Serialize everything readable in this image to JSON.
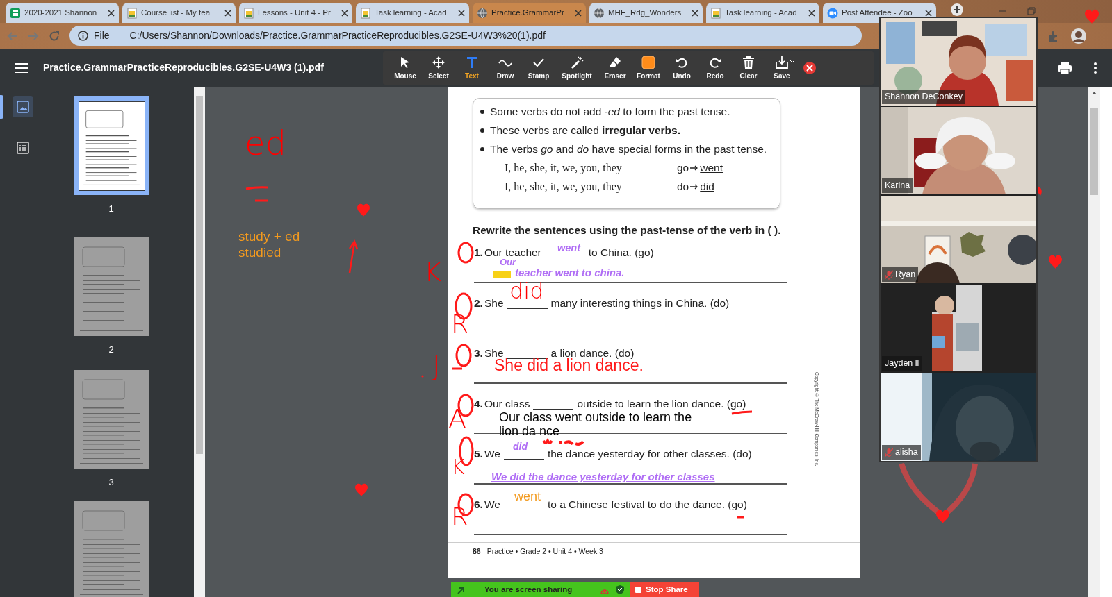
{
  "browser": {
    "tabs": [
      {
        "title": "2020-2021 Shannon",
        "selected": false
      },
      {
        "title": "Course list - My tea",
        "selected": false
      },
      {
        "title": "Lessons - Unit 4 - Pr",
        "selected": false
      },
      {
        "title": "Task learning - Acad",
        "selected": false
      },
      {
        "title": "Practice.GrammarPr",
        "selected": true
      },
      {
        "title": "MHE_Rdg_Wonders",
        "selected": false
      },
      {
        "title": "Task learning - Acad",
        "selected": false
      },
      {
        "title": "Post Attendee - Zoo",
        "selected": false
      }
    ],
    "address": {
      "scheme": "File",
      "url": "C:/Users/Shannon/Downloads/Practice.GrammarPracticeReproducibles.G2SE-U4W3%20(1).pdf"
    }
  },
  "pdf_viewer": {
    "filename": "Practice.GrammarPracticeReproducibles.G2SE-U4W3 (1).pdf",
    "sidebar": {
      "views": [
        {
          "kind": "thumbnails",
          "selected": true
        },
        {
          "kind": "outline",
          "selected": false
        }
      ],
      "thumbnails": [
        {
          "label": "1",
          "selected": true
        },
        {
          "label": "2",
          "selected": false
        },
        {
          "label": "3",
          "selected": false
        },
        {
          "selected": false
        }
      ]
    },
    "page": {
      "rules": [
        {
          "text": "Some verbs do not add *-ed* to form the past tense."
        },
        {
          "text": "These verbs are called **irregular verbs.**"
        },
        {
          "text": "The verbs *go* and *do* have special forms in the past tense."
        }
      ],
      "forms": [
        {
          "pronouns": "I, he, she, it, we, you, they",
          "verb": "go",
          "past": "went"
        },
        {
          "pronouns": "I, he, she, it, we, you, they",
          "verb": "do",
          "past": "did"
        }
      ],
      "instruction": "Rewrite the sentences using the past-tense of the verb in ( ).",
      "questions": [
        {
          "number": "1.",
          "before": "Our teacher",
          "after": "to China. (go)"
        },
        {
          "number": "2.",
          "before": "She",
          "after": "many interesting things in China. (do)"
        },
        {
          "number": "3.",
          "before": "She",
          "after": "a lion dance. (do)"
        },
        {
          "number": "4.",
          "before": "Our class",
          "after": "outside to learn the lion dance. (go)"
        },
        {
          "number": "5.",
          "before": "We",
          "after": "the dance yesterday for other classes. (do)"
        },
        {
          "number": "6.",
          "before": "We",
          "after": "to a Chinese festival to do the dance. (go)"
        }
      ],
      "copyright": "Copyright © The McGraw-Hill Companies, Inc.",
      "footer": {
        "page_number": "86",
        "text": "Practice • Grade 2 • Unit 4 • Week 3"
      }
    }
  },
  "annotation_toolbar": {
    "tools": [
      {
        "label": "Mouse",
        "selected": false
      },
      {
        "label": "Select",
        "selected": false
      },
      {
        "label": "Text",
        "selected": true
      },
      {
        "label": "Draw",
        "selected": false
      },
      {
        "label": "Stamp",
        "selected": false
      },
      {
        "label": "Spotlight",
        "selected": false
      },
      {
        "label": "Eraser",
        "selected": false
      },
      {
        "label": "Format",
        "selected": false
      },
      {
        "label": "Undo",
        "selected": false
      },
      {
        "label": "Redo",
        "selected": false
      },
      {
        "label": "Clear",
        "selected": false
      },
      {
        "label": "Save",
        "selected": false
      }
    ]
  },
  "annotations": [
    {
      "kind": "ink",
      "text": "ed",
      "color": "#ff0000"
    },
    {
      "kind": "typed",
      "text": "study + ed",
      "color": "#f39a1e"
    },
    {
      "kind": "typed",
      "text": "studied",
      "color": "#f39a1e"
    },
    {
      "kind": "ink",
      "text": "K",
      "color": "#ff0000"
    },
    {
      "kind": "typed",
      "text": "went",
      "color": "#b06ef5"
    },
    {
      "kind": "typed",
      "text": "Our",
      "color": "#b06ef5"
    },
    {
      "kind": "typed",
      "text": "teacher went to china.",
      "color": "#b06ef5"
    },
    {
      "kind": "ink",
      "text": "R",
      "color": "#ff0000"
    },
    {
      "kind": "ink",
      "text": "did",
      "color": "#ff0000"
    },
    {
      "kind": "ink",
      "text": "J",
      "color": "#ff0000"
    },
    {
      "kind": "typed",
      "text": "She did a lion dance.",
      "color": "#ff1a1a"
    },
    {
      "kind": "ink",
      "text": "A",
      "color": "#ff0000"
    },
    {
      "kind": "typed",
      "text": "Our class went outside to learn the",
      "color": "#000000"
    },
    {
      "kind": "typed",
      "text": "lion da nce",
      "color": "#000000"
    },
    {
      "kind": "ink",
      "text": "K",
      "color": "#ff0000"
    },
    {
      "kind": "typed",
      "text": "did",
      "color": "#b06ef5"
    },
    {
      "kind": "typed",
      "text": "We did the dance yesterday for other classes",
      "color": "#b06ef5"
    },
    {
      "kind": "typed",
      "text": "went",
      "color": "#f39a1e"
    },
    {
      "kind": "ink",
      "text": "R",
      "color": "#ff0000"
    }
  ],
  "video_panel": {
    "participants": [
      {
        "name": "Shannon DeConkey",
        "muted": false
      },
      {
        "name": "Karina",
        "muted": false
      },
      {
        "name": "Ryan",
        "muted": true
      },
      {
        "name": "Jayden ll",
        "muted": false
      },
      {
        "name": "alisha",
        "muted": true
      }
    ]
  },
  "share_bar": {
    "status": "You are screen sharing",
    "stop": "Stop Share"
  }
}
